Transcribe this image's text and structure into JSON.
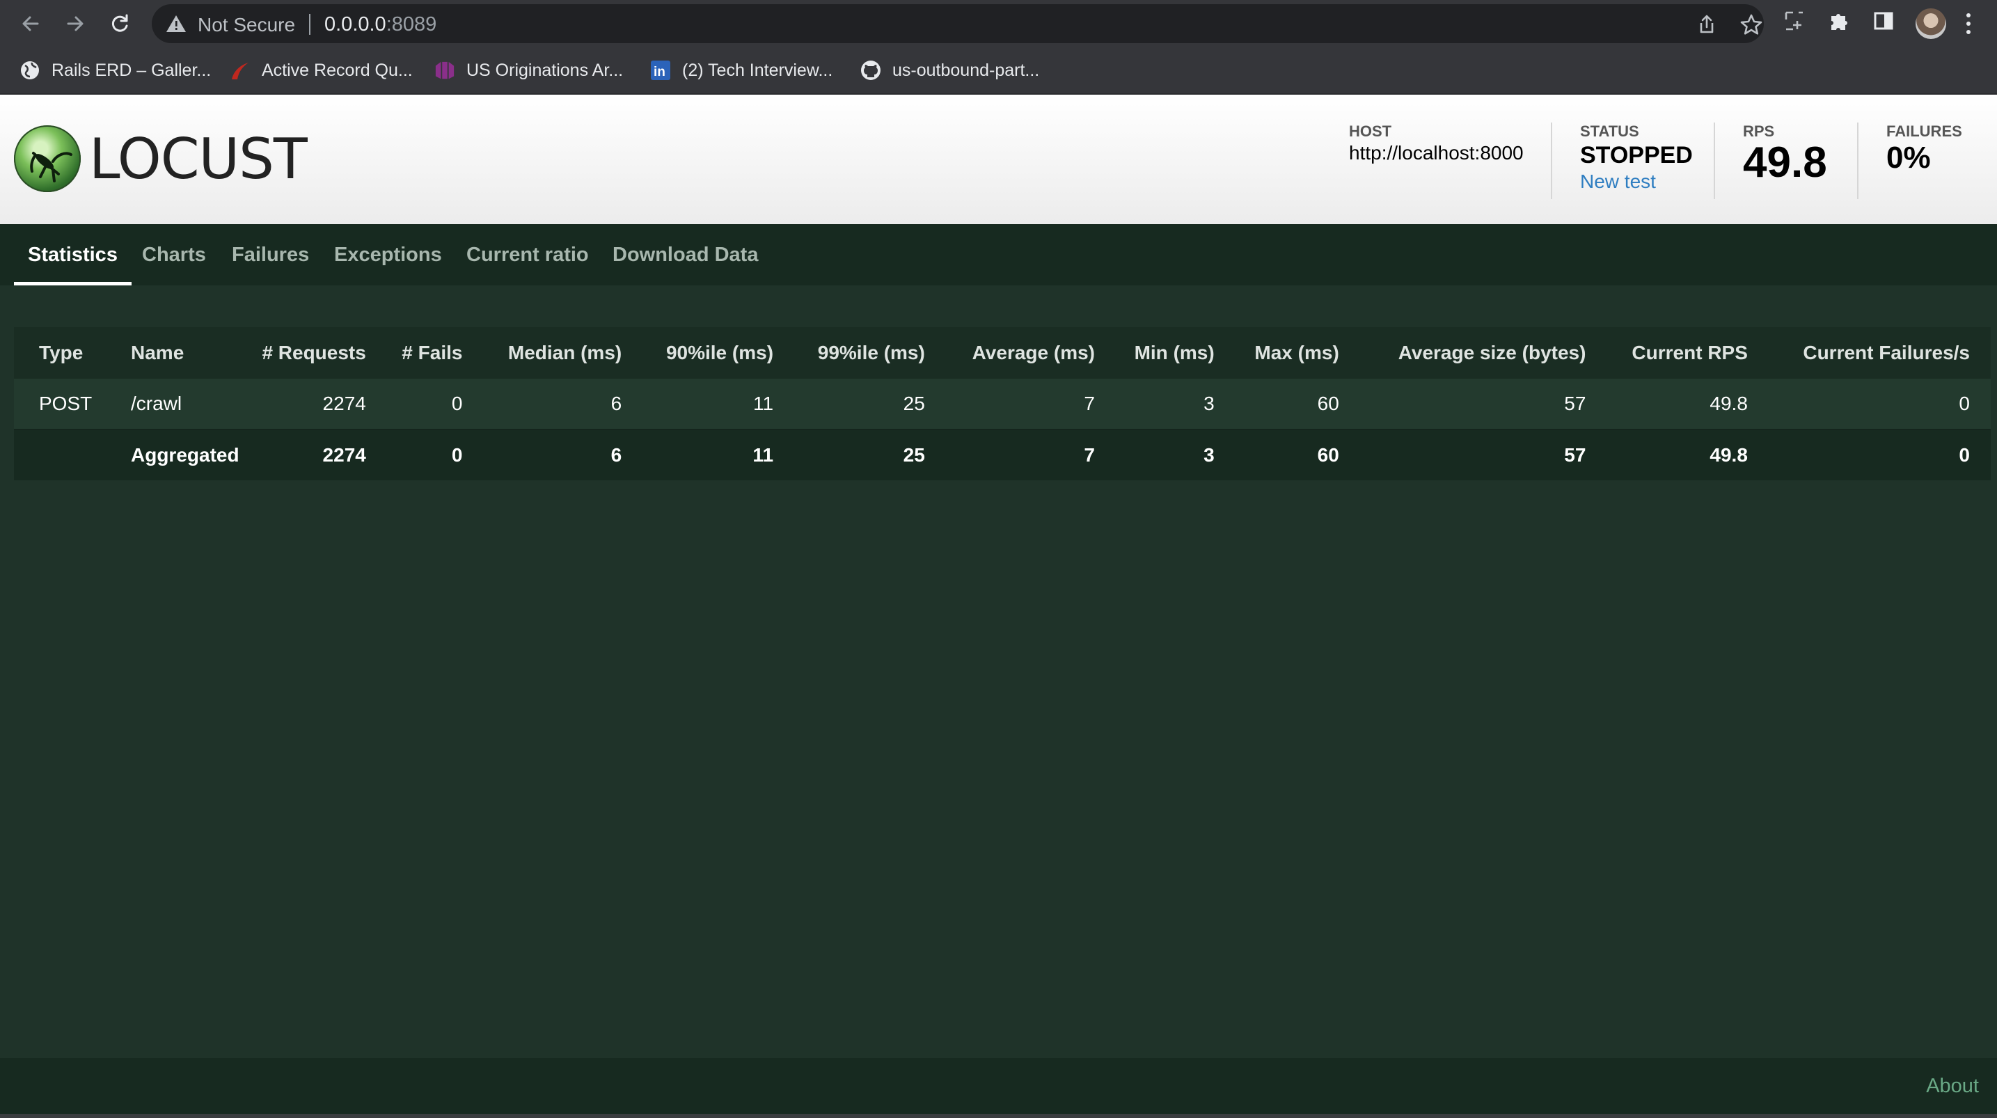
{
  "browser": {
    "security_label": "Not Secure",
    "url_host": "0.0.0.0",
    "url_port": ":8089",
    "bookmarks": [
      {
        "label": "Rails ERD – Galler...",
        "icon": "globe-icon"
      },
      {
        "label": "Active Record Qu...",
        "icon": "rails-icon"
      },
      {
        "label": "US Originations Ar...",
        "icon": "grid-app-icon"
      },
      {
        "label": "(2) Tech Interview...",
        "icon": "linkedin-icon"
      },
      {
        "label": "us-outbound-part...",
        "icon": "github-icon"
      }
    ],
    "colors": {
      "chrome": "#35363a",
      "omnibox": "#202124"
    }
  },
  "header": {
    "logo_text": "LOCUST",
    "host_label": "HOST",
    "host_value": "http://localhost:8000",
    "status_label": "STATUS",
    "status_value": "STOPPED",
    "new_test_label": "New test",
    "rps_label": "RPS",
    "rps_value": "49.8",
    "failures_label": "FAILURES",
    "failures_value": "0%"
  },
  "tabs": [
    {
      "label": "Statistics",
      "active": true
    },
    {
      "label": "Charts",
      "active": false
    },
    {
      "label": "Failures",
      "active": false
    },
    {
      "label": "Exceptions",
      "active": false
    },
    {
      "label": "Current ratio",
      "active": false
    },
    {
      "label": "Download Data",
      "active": false
    }
  ],
  "table": {
    "headers": [
      "Type",
      "Name",
      "# Requests",
      "# Fails",
      "Median (ms)",
      "90%ile (ms)",
      "99%ile (ms)",
      "Average (ms)",
      "Min (ms)",
      "Max (ms)",
      "Average size (bytes)",
      "Current RPS",
      "Current Failures/s"
    ],
    "rows": [
      [
        "POST",
        "/crawl",
        "2274",
        "0",
        "6",
        "11",
        "25",
        "7",
        "3",
        "60",
        "57",
        "49.8",
        "0"
      ]
    ],
    "aggregated": [
      "",
      "Aggregated",
      "2274",
      "0",
      "6",
      "11",
      "25",
      "7",
      "3",
      "60",
      "57",
      "49.8",
      "0"
    ]
  },
  "footer": {
    "about_label": "About"
  },
  "theme": {
    "background": "#1f3329",
    "tabbar": "#172a20",
    "link": "#2f7ec1",
    "about_link": "#6aa986"
  }
}
